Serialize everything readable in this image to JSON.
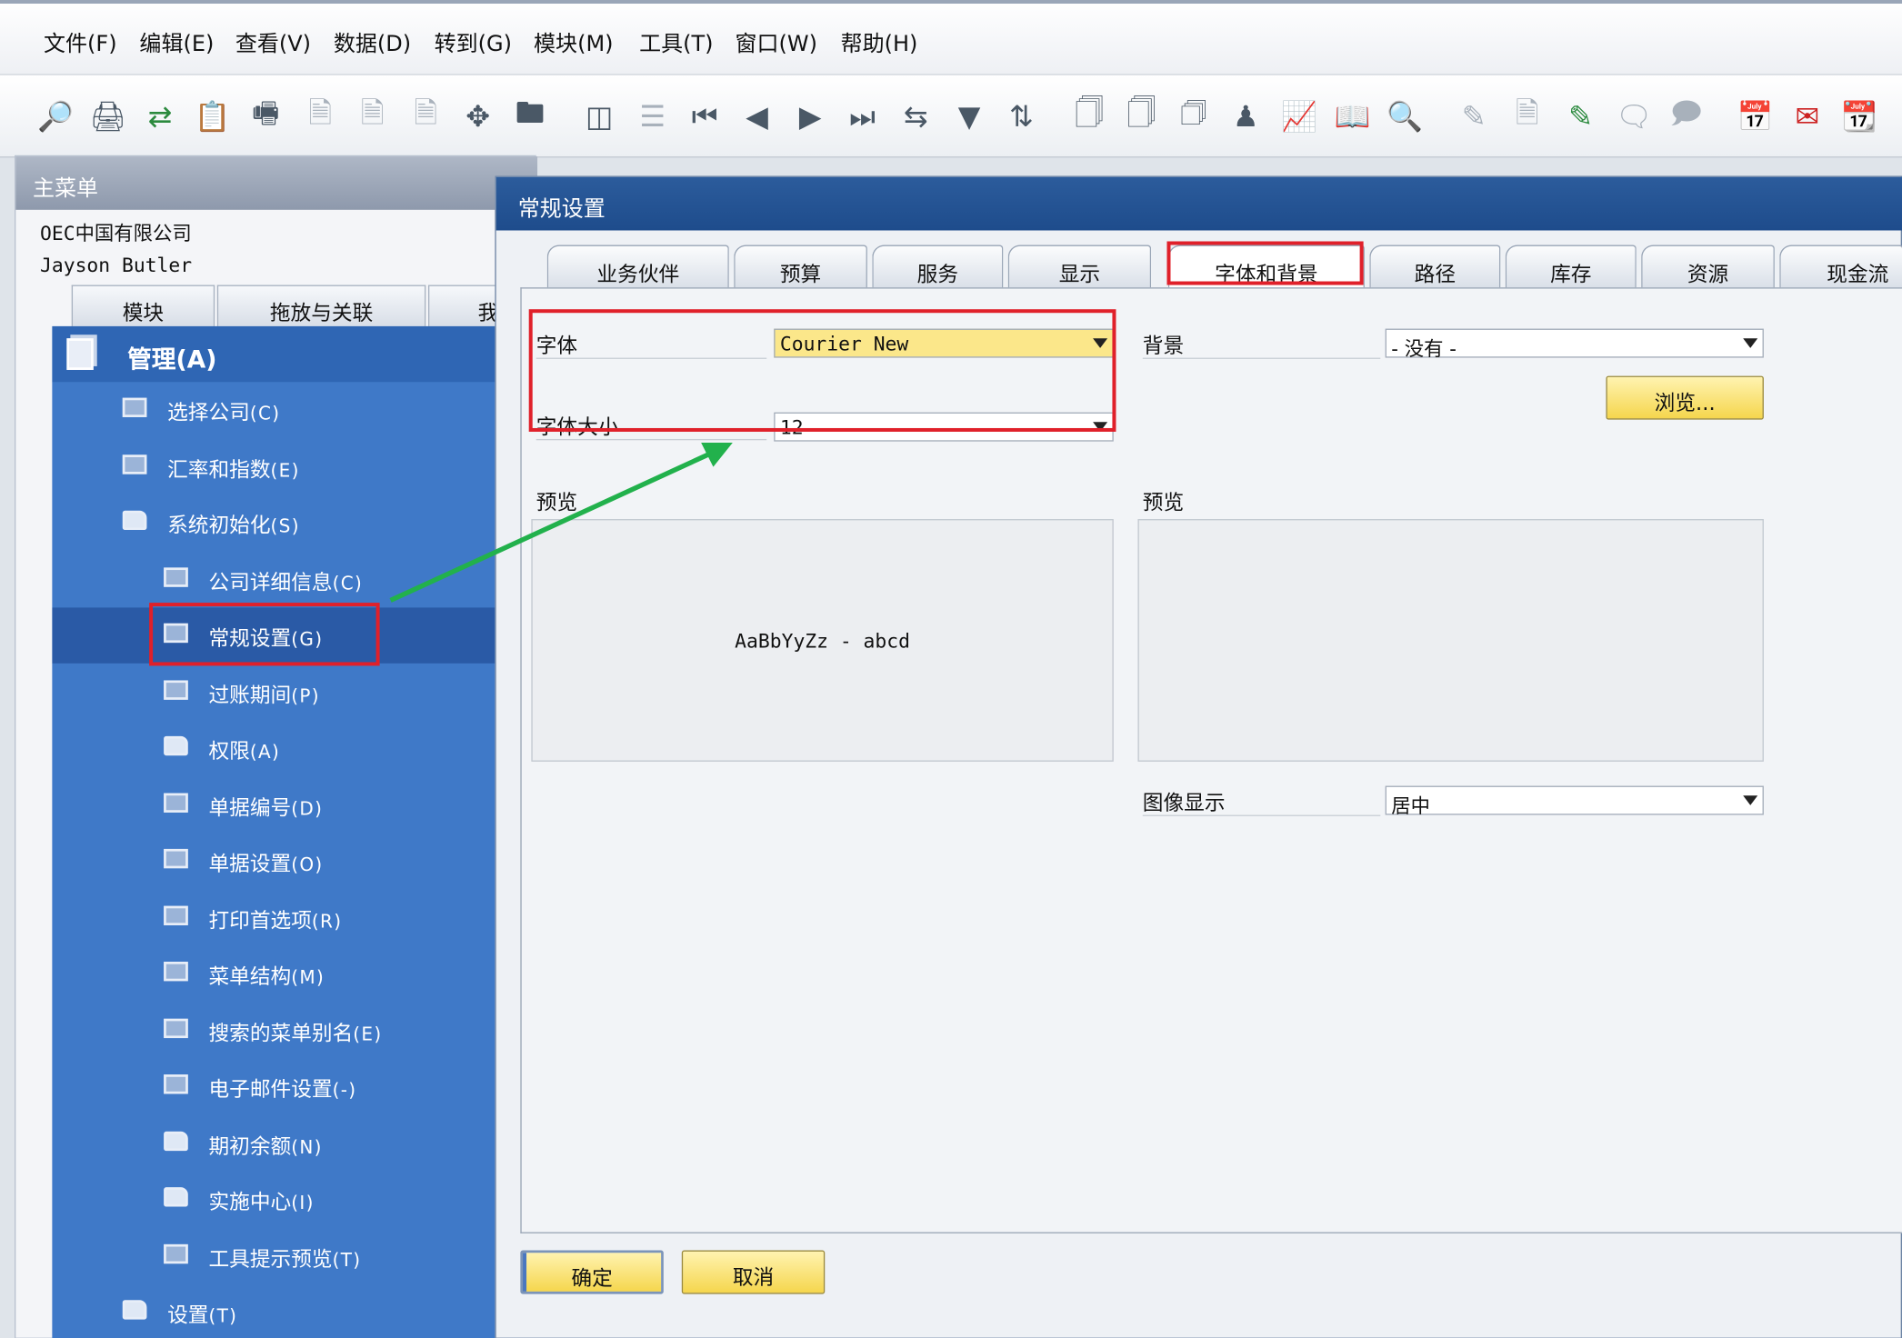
{
  "menubar": {
    "items": [
      "文件(F)",
      "编辑(E)",
      "查看(V)",
      "数据(D)",
      "转到(G)",
      "模块(M)",
      "工具(T)",
      "窗口(W)",
      "帮助(H)"
    ]
  },
  "toolbar": {
    "icons": [
      "print-preview-icon",
      "print-icon",
      "send-icon",
      "export-icon",
      "fax-icon",
      "pdf-icon",
      "word-icon",
      "excel-icon",
      "navigate-icon",
      "lock-icon",
      "find-icon",
      "list-icon",
      "first-record-icon",
      "previous-record-icon",
      "next-record-icon",
      "last-record-icon",
      "refresh-icon",
      "filter-icon",
      "sort-icon",
      "base-document-icon",
      "target-document-icon",
      "journal-icon",
      "user-icon",
      "chart-icon",
      "book-icon",
      "search-doc-icon",
      "edit-icon",
      "document-settings-icon",
      "form-settings-icon",
      "message-icon",
      "messages-icon",
      "alert-calendar-icon",
      "mail-alert-icon",
      "calendar-icon"
    ]
  },
  "main_menu": {
    "title": "主菜单",
    "company": "OEC中国有限公司",
    "user": "Jayson Butler",
    "tabs": [
      "模块",
      "拖放与关联",
      "我"
    ],
    "root": {
      "label": "管理",
      "key": "(A)"
    },
    "items": [
      {
        "label": "选择公司",
        "key": "(C)",
        "icon": "window-icon",
        "level": 1
      },
      {
        "label": "汇率和指数",
        "key": "(E)",
        "icon": "window-icon",
        "level": 1
      },
      {
        "label": "系统初始化",
        "key": "(S)",
        "icon": "folder-open-icon",
        "level": 1
      },
      {
        "label": "公司详细信息",
        "key": "(C)",
        "icon": "window-icon",
        "level": 2
      },
      {
        "label": "常规设置",
        "key": "(G)",
        "icon": "window-icon",
        "level": 2,
        "selected": true
      },
      {
        "label": "过账期间",
        "key": "(P)",
        "icon": "window-icon",
        "level": 2
      },
      {
        "label": "权限",
        "key": "(A)",
        "icon": "folder-icon",
        "level": 2
      },
      {
        "label": "单据编号",
        "key": "(D)",
        "icon": "window-icon",
        "level": 2
      },
      {
        "label": "单据设置",
        "key": "(O)",
        "icon": "window-icon",
        "level": 2
      },
      {
        "label": "打印首选项",
        "key": "(R)",
        "icon": "window-icon",
        "level": 2
      },
      {
        "label": "菜单结构",
        "key": "(M)",
        "icon": "window-icon",
        "level": 2
      },
      {
        "label": "搜索的菜单别名",
        "key": "(E)",
        "icon": "window-icon",
        "level": 2
      },
      {
        "label": "电子邮件设置",
        "key": "(-)",
        "icon": "window-icon",
        "level": 2
      },
      {
        "label": "期初余额",
        "key": "(N)",
        "icon": "folder-icon",
        "level": 2
      },
      {
        "label": "实施中心",
        "key": "(I)",
        "icon": "folder-icon",
        "level": 2
      },
      {
        "label": "工具提示预览",
        "key": "(T)",
        "icon": "window-icon",
        "level": 2
      },
      {
        "label": "设置",
        "key": "(T)",
        "icon": "folder-icon",
        "level": 1
      }
    ]
  },
  "dialog": {
    "title": "常规设置",
    "tabs": [
      "业务伙伴",
      "预算",
      "服务",
      "显示",
      "字体和背景",
      "路径",
      "库存",
      "资源",
      "现金流"
    ],
    "active_tab": "字体和背景",
    "font_label": "字体",
    "font_value": "Courier New",
    "font_size_label": "字体大小",
    "font_size_value": "12",
    "left_preview_label": "预览",
    "preview_sample": "AaBbYyZz - abcd",
    "background_label": "背景",
    "background_value": "- 没有 -",
    "browse_button": "浏览...",
    "right_preview_label": "预览",
    "image_display_label": "图像显示",
    "image_display_value": "居中",
    "ok_button": "确定",
    "cancel_button": "取消"
  },
  "colors": {
    "tree_bg": "#3f79c8",
    "tree_selected": "#2a5aa6",
    "dialog_title": "#1e4c8c",
    "highlight_combo": "#fbe78a",
    "button_yellow": "#f5d64d",
    "annotation_red": "#e0202a",
    "annotation_green": "#22b14c"
  }
}
